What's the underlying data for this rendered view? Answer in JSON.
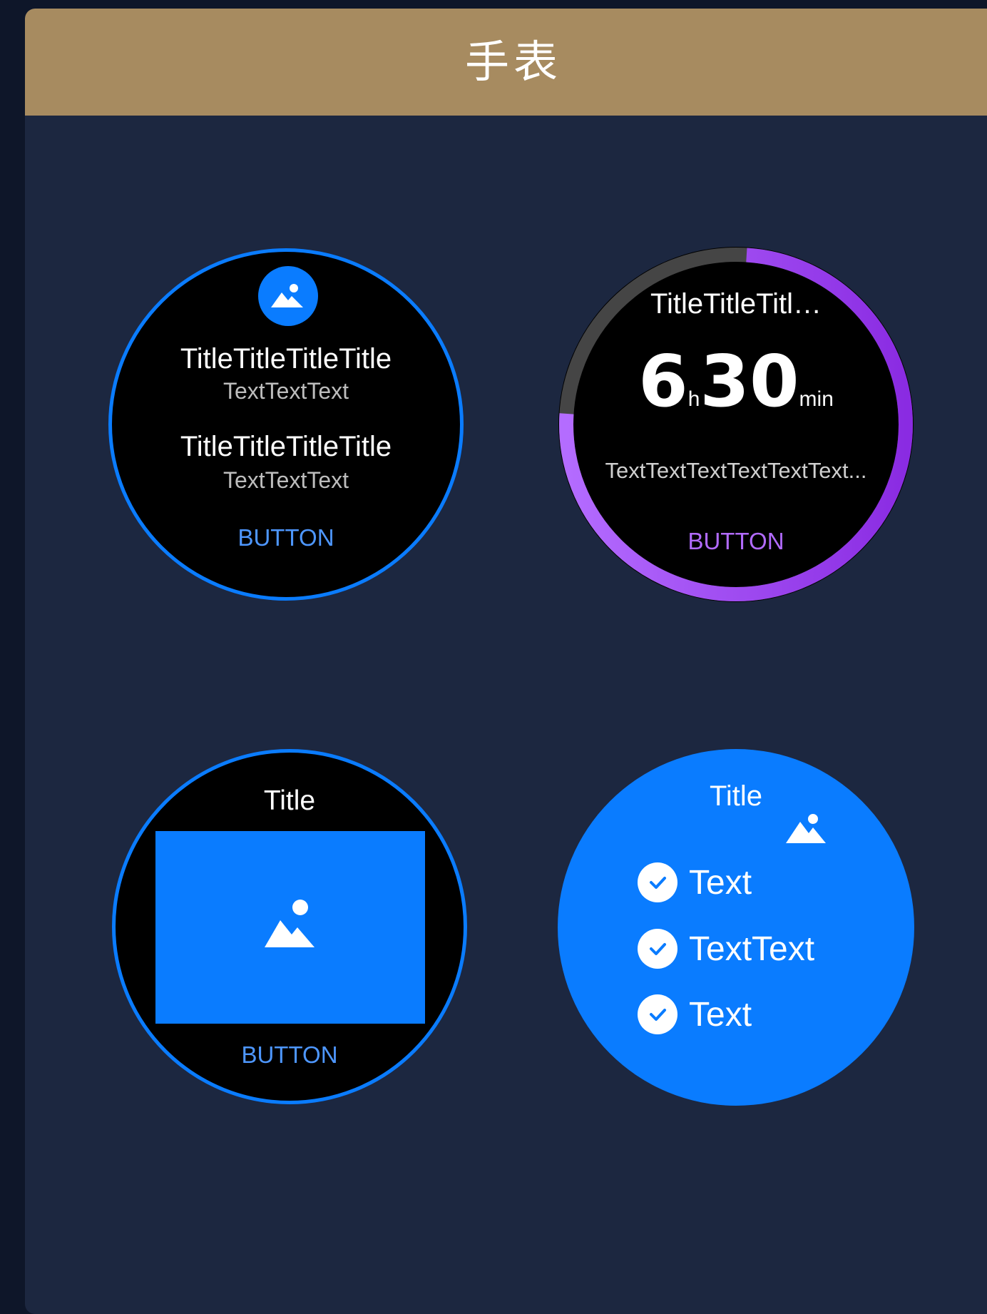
{
  "header": {
    "title": "手表"
  },
  "colors": {
    "header_bg": "#a78b60",
    "panel_bg": "#1c2740",
    "accent_blue": "#0a7cff",
    "accent_purple": "#a24cf0"
  },
  "watch1": {
    "icon": "image-icon",
    "title1": "TitleTitleTitleTitle",
    "text1": "TextTextText",
    "title2": "TitleTitleTitleTitle",
    "text2": "TextTextText",
    "button": "BUTTON"
  },
  "watch2": {
    "title": "TitleTitleTitl…",
    "hours": "6",
    "hours_unit": "h",
    "minutes": "30",
    "minutes_unit": "min",
    "text": "TextTextTextTextTextText...",
    "button": "BUTTON",
    "progress": 0.75
  },
  "watch3": {
    "title": "Title",
    "icon": "image-icon",
    "button": "BUTTON"
  },
  "watch4": {
    "title": "Title",
    "icon": "image-icon",
    "items": [
      {
        "icon": "check-circle-icon",
        "label": "Text"
      },
      {
        "icon": "check-circle-icon",
        "label": "TextText"
      },
      {
        "icon": "check-circle-icon",
        "label": "Text"
      }
    ]
  }
}
